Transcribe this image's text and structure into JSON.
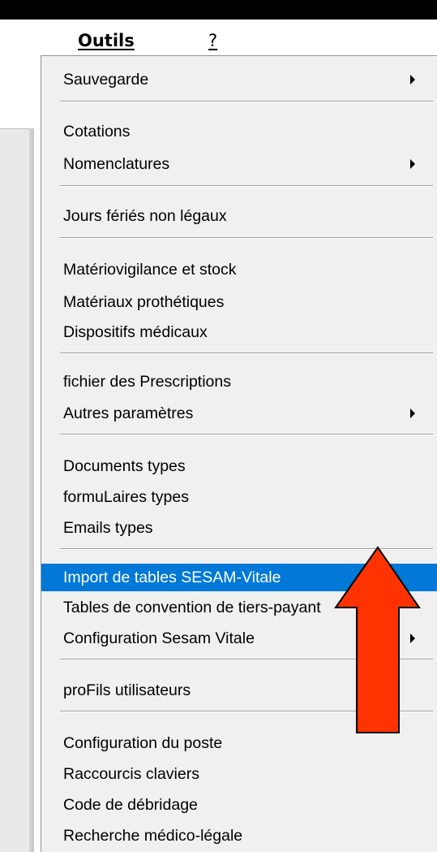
{
  "menubar": {
    "outils_label": "Outils",
    "help_label": "?"
  },
  "menu": {
    "sauvegarde": "Sauvegarde",
    "cotations": "Cotations",
    "nomenclatures": "Nomenclatures",
    "jours_feries": "Jours fériés non légaux",
    "materiovigilance": "Matériovigilance et stock",
    "materiaux": "Matériaux prothétiques",
    "dispositifs": "Dispositifs médicaux",
    "prescriptions": "fichier des Prescriptions",
    "autres_parametres": "Autres paramètres",
    "documents_types": "Documents types",
    "formulaires_types": "formuLaires types",
    "emails_types": "Emails types",
    "import_sesam": "Import de tables SESAM-Vitale",
    "tables_convention": "Tables de convention de tiers-payant",
    "config_sesam": "Configuration Sesam Vitale",
    "profils": "proFils utilisateurs",
    "config_poste": "Configuration du poste",
    "raccourcis": "Raccourcis claviers",
    "code_debridage": "Code de débridage",
    "recherche_ml": "Recherche médico-légale"
  },
  "colors": {
    "highlight": "#0078d7",
    "menu_bg": "#f0f0f0",
    "annotation_arrow": "#ff3300"
  }
}
